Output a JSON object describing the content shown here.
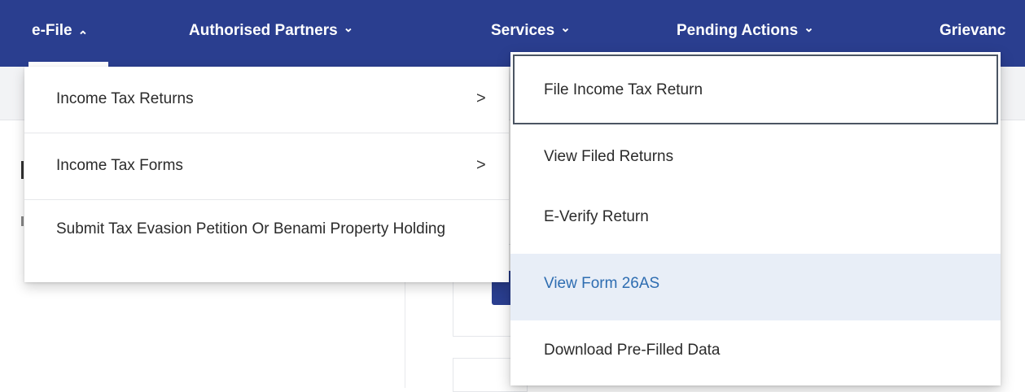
{
  "nav": {
    "items": [
      {
        "label": "e-File",
        "chevron": "⌃"
      },
      {
        "label": "Authorised Partners",
        "chevron": "⌄"
      },
      {
        "label": "Services",
        "chevron": "⌄"
      },
      {
        "label": "Pending Actions",
        "chevron": "⌄"
      },
      {
        "label": "Grievanc"
      }
    ]
  },
  "efile_menu": {
    "items": [
      {
        "label": "Income Tax Returns",
        "arrow": ">"
      },
      {
        "label": "Income Tax Forms",
        "arrow": ">"
      },
      {
        "label": "Submit Tax Evasion Petition Or Benami Property Holding"
      }
    ]
  },
  "returns_submenu": {
    "items": [
      {
        "label": "File Income Tax Return"
      },
      {
        "label": "View Filed Returns"
      },
      {
        "label": "E-Verify Return"
      },
      {
        "label": "View Form 26AS"
      },
      {
        "label": "Download Pre-Filled Data"
      }
    ]
  },
  "colors": {
    "navbar": "#2a3e8f",
    "hover_bg": "#e8eef7",
    "hover_text": "#2e6db1"
  }
}
